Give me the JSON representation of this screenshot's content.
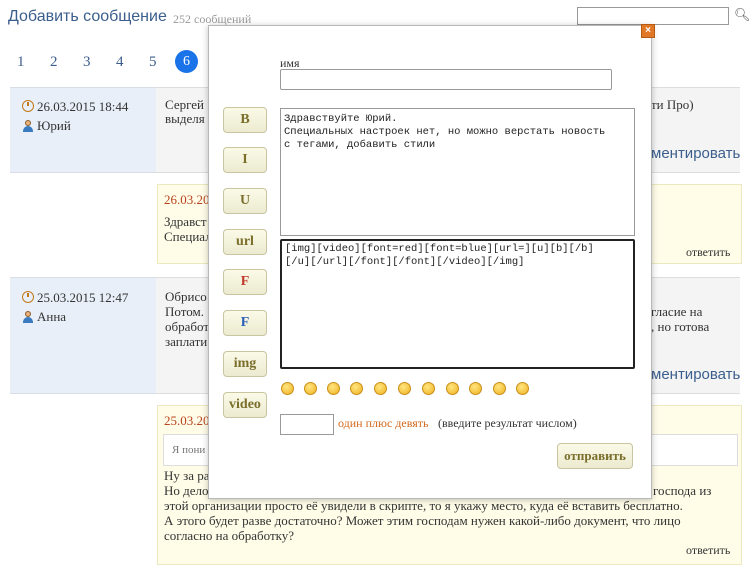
{
  "header": {
    "title": "Добавить сообщение",
    "count": "252 сообщений"
  },
  "pagination": [
    "1",
    "2",
    "3",
    "4",
    "5",
    "6"
  ],
  "messages": [
    {
      "date": "26.03.2015 18:44",
      "author": "Юрий",
      "text1": "Сергей",
      "text2": "выделя",
      "tail": "ти Про)",
      "comment": "ментировать"
    },
    {
      "date": "26.03.20",
      "text1": "Здравст",
      "text2": "Специал",
      "reply": "ответить"
    },
    {
      "date": "25.03.2015 12:47",
      "author": "Анна",
      "text1": "Обрисо",
      "text2": "Потом.",
      "text3": "обработ",
      "text4": "заплати",
      "tail1": "гласие на",
      "tail2": ", но готова",
      "comment": "ментировать"
    },
    {
      "date": "25.03.20",
      "quote": "Я пони",
      "line1a": "Ну за ра",
      "line2a": "Но дело",
      "line2b": "господа из",
      "line3": "этой организации просто её увидели в скрипте, то я укажу место, куда её вставить бесплатно.",
      "line4": "А этого будет разве достаточно? Может этим господам нужен какой-либо документ, что лицо",
      "line5": "согласно на обработку?",
      "reply": "ответить"
    }
  ],
  "modal": {
    "buttons": [
      "B",
      "I",
      "U",
      "url",
      "F",
      "F",
      "img",
      "video"
    ],
    "button_colors": [
      "#7a6e2a",
      "#7a6e2a",
      "#7a6e2a",
      "#7a6e2a",
      "#c0392b",
      "#2b5fb8",
      "#7a6e2a",
      "#7a6e2a"
    ],
    "name_label": "имя",
    "name_value": "",
    "message_text": "Здравствуйте Юрий.\nСпециальных настроек нет, но можно верстать новость\nс тегами, добавить стили",
    "tags_text": "[img][video][font=red][font=blue][url=][u][b][/b]\n[/u][/url][/font][/font][/video][/img]",
    "captcha_question": "один плюс девять",
    "captcha_hint": "(введите результат числом)",
    "captcha_value": "",
    "send_label": "отправить",
    "close": "×"
  }
}
